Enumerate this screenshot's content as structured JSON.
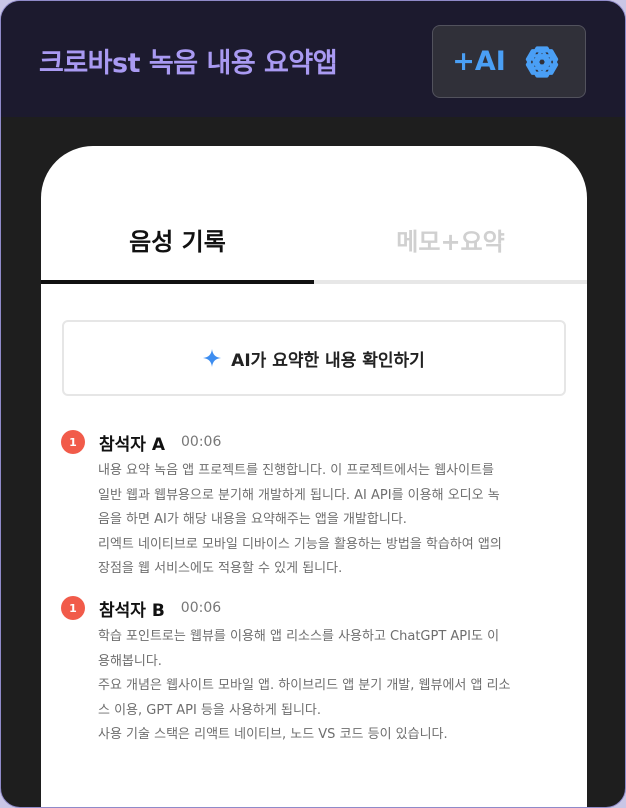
{
  "header": {
    "title": "크로바st 녹음 내용 요약앱",
    "badge_label": "+AI",
    "badge_icon": "openai-logo-icon",
    "badge_color": "#4a9ff5",
    "title_color": "#a99af2"
  },
  "tabs": [
    {
      "label": "음성 기록",
      "active": true
    },
    {
      "label": "메모+요약",
      "active": false
    }
  ],
  "summary_button": {
    "icon": "sparkle-icon",
    "label": "AI가 요약한 내용 확인하기"
  },
  "entries": [
    {
      "number": "1",
      "speaker": "참석자 A",
      "time": "00:06",
      "lines": [
        "내용 요약 녹음 앱 프로젝트를 진행합니다. 이 프로젝트에서는 웹사이트를",
        "일반 웹과 웹뷰용으로 분기해 개발하게 됩니다. AI API를 이용해 오디오 녹",
        "음을 하면 AI가 해당 내용을 요약해주는 앱을 개발합니다.",
        "리엑트 네이티브로 모바일 디바이스 기능을 활용하는 방법을 학습하여 앱의",
        "장점을 웹 서비스에도 적용할 수 있게 됩니다."
      ]
    },
    {
      "number": "1",
      "speaker": "참석자 B",
      "time": "00:06",
      "lines": [
        "학습 포인트로는 웹뷰를 이용해 앱 리소스를 사용하고 ChatGPT API도 이",
        "용해봅니다.",
        "주요 개념은 웹사이트 모바일 앱. 하이브리드 앱 분기 개발, 웹뷰에서 앱 리소",
        "스 이용, GPT API 등을 사용하게 됩니다.",
        "사용 기술 스택은 리액트 네이티브, 노드 VS 코드 등이 있습니다."
      ]
    }
  ]
}
